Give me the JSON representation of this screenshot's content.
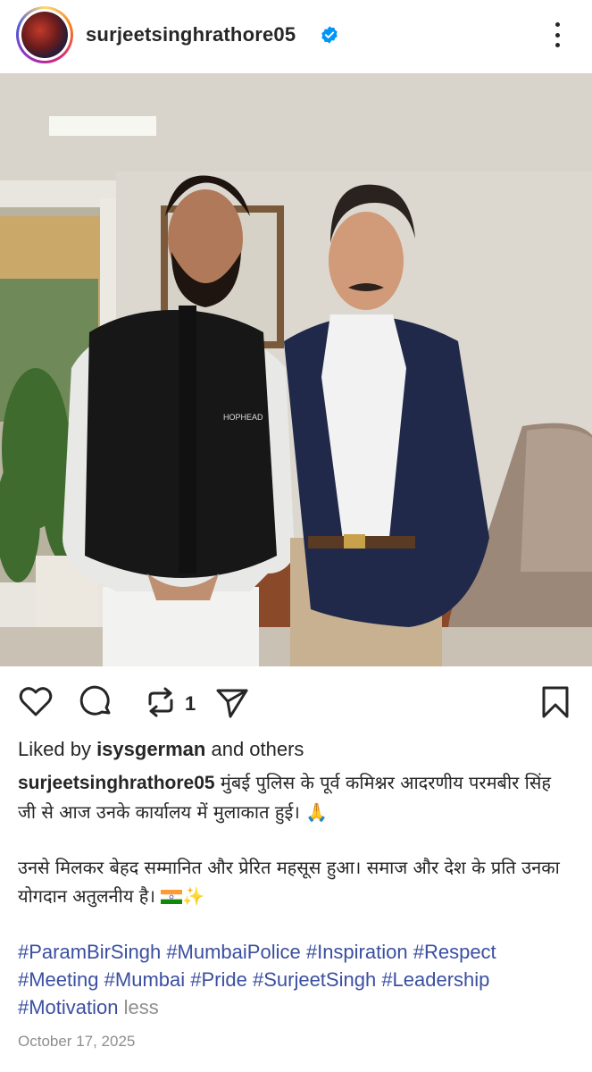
{
  "post": {
    "username": "surjeetsinghrathore05",
    "verified_icon": "verified-badge-icon",
    "more_icon": "more-options-icon"
  },
  "actions": {
    "like_icon": "heart-icon",
    "comment_icon": "comment-icon",
    "repost_icon": "repost-icon",
    "repost_count": "1",
    "share_icon": "send-icon",
    "save_icon": "bookmark-icon"
  },
  "likes": {
    "prefix": "Liked by ",
    "user": "isysgerman",
    "suffix": " and others"
  },
  "caption": {
    "username": "surjeetsinghrathore05",
    "line1": " मुंबई पुलिस के पूर्व कमिश्नर आदरणीय परमबीर सिंह जी से आज उनके कार्यालय  में मुलाकात हुई। 🙏",
    "line2": "उनसे मिलकर बेहद सम्मानित और प्रेरित महसूस हुआ। समाज और देश के प्रति उनका योगदान अतुलनीय है। ",
    "emoji_after_flag": "✨"
  },
  "hashtags": [
    "#ParamBirSingh",
    "#MumbaiPolice",
    "#Inspiration",
    "#Respect",
    "#Meeting",
    "#Mumbai",
    "#Pride",
    "#SurjeetSingh",
    "#Leadership",
    "#Motivation"
  ],
  "less_label": "less",
  "date": "October 17, 2025",
  "photo_text": {
    "vest_label": "HOPHEAD"
  },
  "colors": {
    "hashtag": "#3b4fa0",
    "verified": "#0095f6",
    "secondary": "#8e8e8e"
  }
}
